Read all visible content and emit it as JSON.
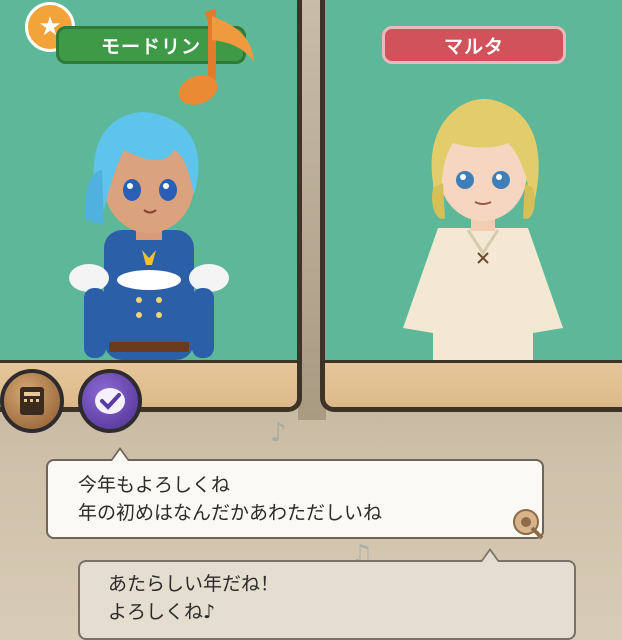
{
  "left_character": {
    "name": "モードリン"
  },
  "right_character": {
    "name": "マルタ"
  },
  "dialog": {
    "top_lines": [
      "今年もよろしくね",
      "年の初めはなんだかあわただしいね"
    ],
    "bottom_lines": [
      "あたらしい年だね！",
      "よろしくね♪"
    ]
  },
  "colors": {
    "panel_sky": "#5cb898",
    "name_green": "#3e9a47",
    "name_red": "#d1525a",
    "badge_orange": "#f2a33a"
  },
  "icons": [
    "star-icon",
    "music-note-icon",
    "book-icon",
    "checkmark-icon",
    "pin-icon"
  ]
}
